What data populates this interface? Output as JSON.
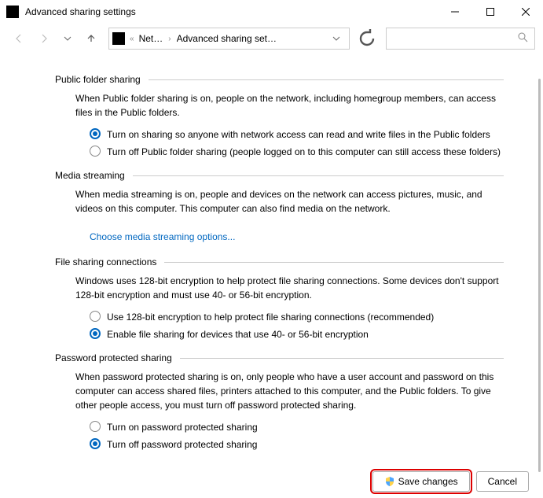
{
  "window": {
    "title": "Advanced sharing settings"
  },
  "breadcrumb": {
    "seg1": "Net…",
    "seg2": "Advanced sharing set…"
  },
  "sections": {
    "publicFolder": {
      "header": "Public folder sharing",
      "desc": "When Public folder sharing is on, people on the network, including homegroup members, can access files in the Public folders.",
      "opt1": "Turn on sharing so anyone with network access can read and write files in the Public folders",
      "opt2": "Turn off Public folder sharing (people logged on to this computer can still access these folders)"
    },
    "media": {
      "header": "Media streaming",
      "desc": "When media streaming is on, people and devices on the network can access pictures, music, and videos on this computer. This computer can also find media on the network.",
      "link": "Choose media streaming options..."
    },
    "fileSharing": {
      "header": "File sharing connections",
      "desc": "Windows uses 128-bit encryption to help protect file sharing connections. Some devices don't support 128-bit encryption and must use 40- or 56-bit encryption.",
      "opt1": "Use 128-bit encryption to help protect file sharing connections (recommended)",
      "opt2": "Enable file sharing for devices that use 40- or 56-bit encryption"
    },
    "password": {
      "header": "Password protected sharing",
      "desc": "When password protected sharing is on, only people who have a user account and password on this computer can access shared files, printers attached to this computer, and the Public folders. To give other people access, you must turn off password protected sharing.",
      "opt1": "Turn on password protected sharing",
      "opt2": "Turn off password protected sharing"
    }
  },
  "buttons": {
    "save": "Save changes",
    "cancel": "Cancel"
  }
}
